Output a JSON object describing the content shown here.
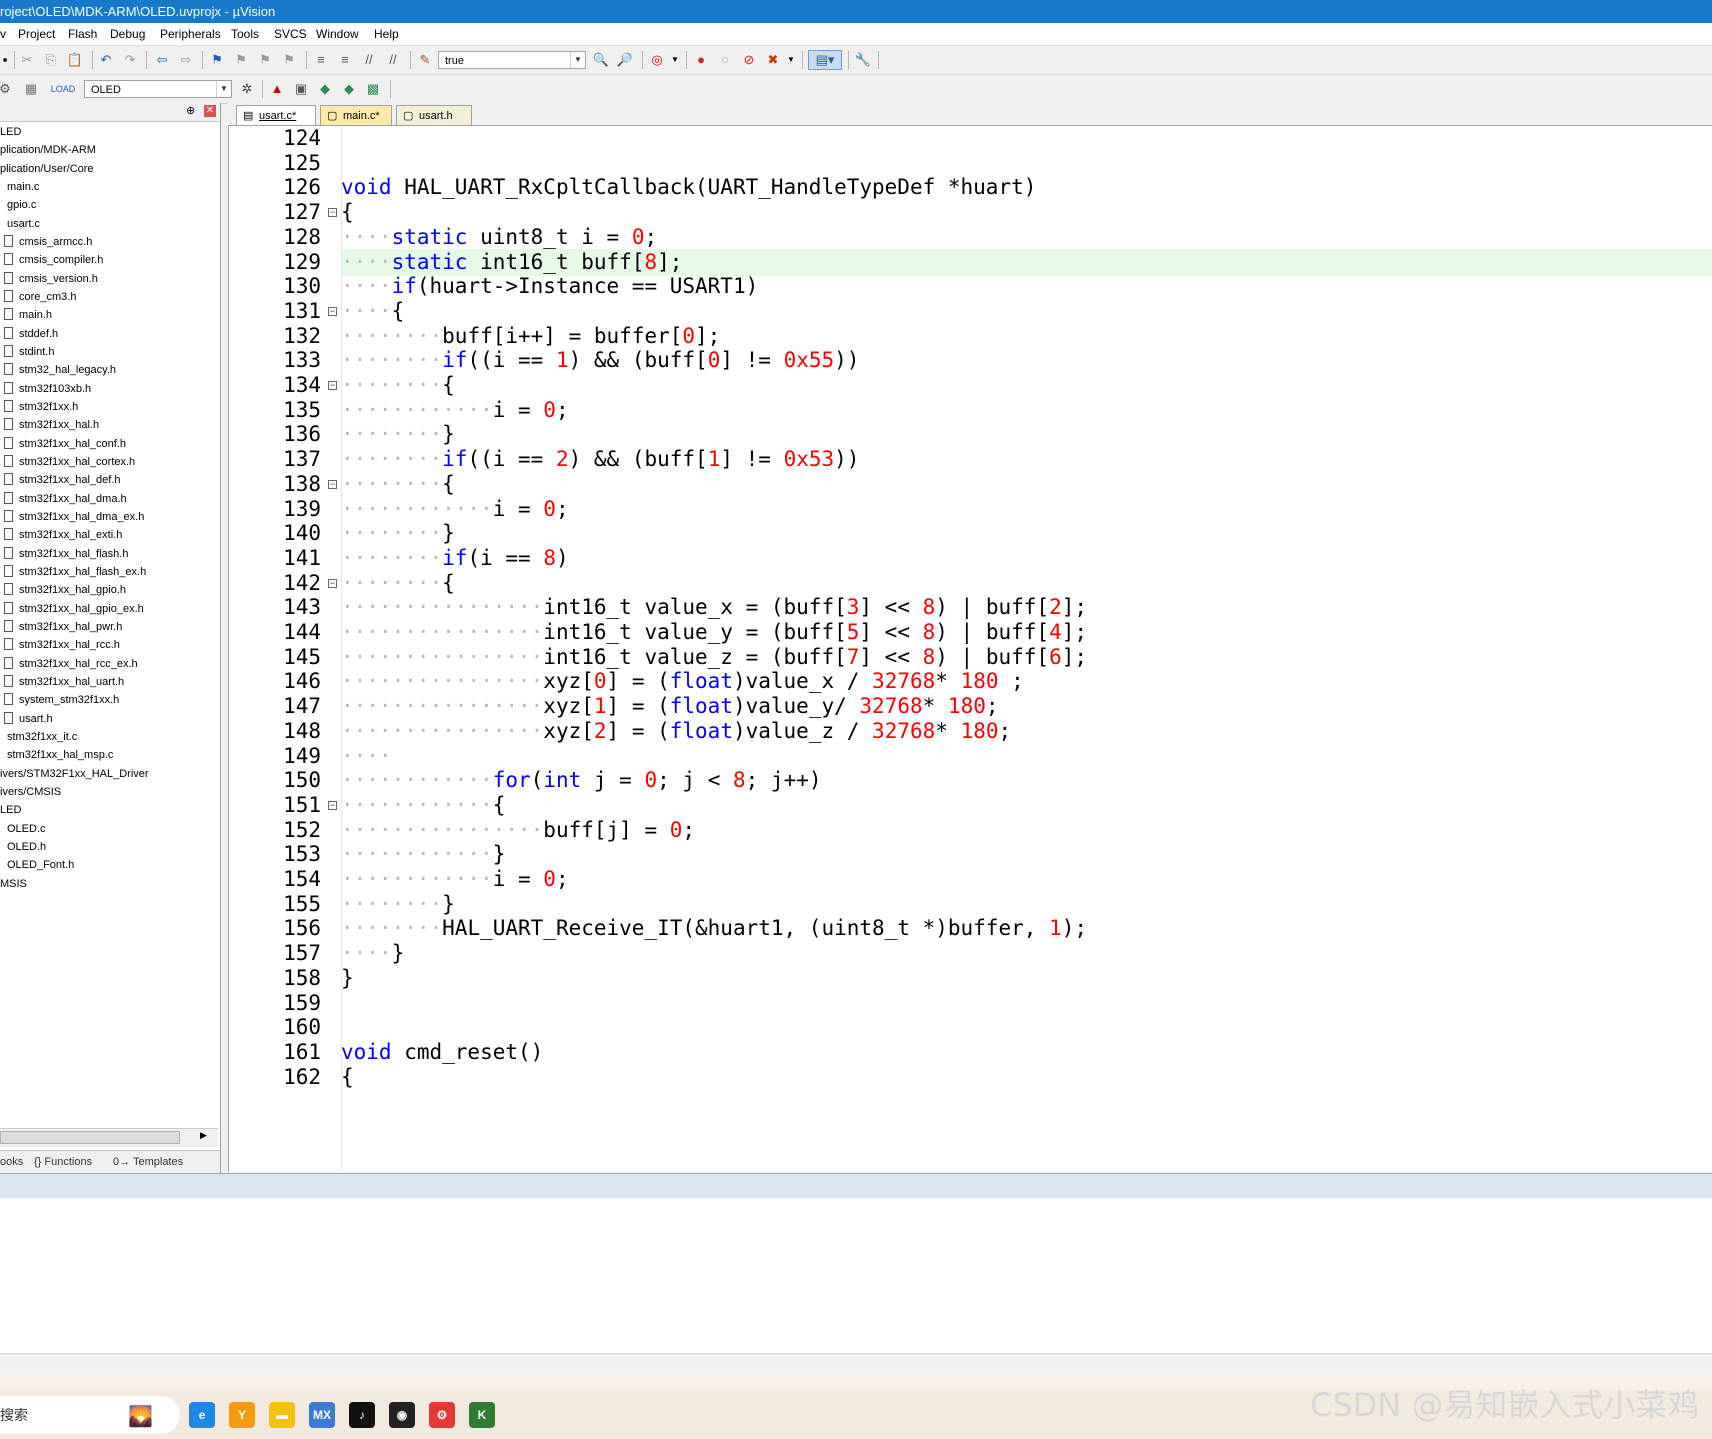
{
  "window": {
    "title": "roject\\OLED\\MDK-ARM\\OLED.uvprojx - µVision"
  },
  "menu": {
    "items": [
      "v",
      "Project",
      "Flash",
      "Debug",
      "Peripherals",
      "Tools",
      "SVCS",
      "Window",
      "Help"
    ]
  },
  "toolbar": {
    "find_combo_value": "true",
    "target_combo_value": "OLED"
  },
  "project": {
    "items": [
      {
        "label": "LED",
        "indent": 0,
        "file": false
      },
      {
        "label": "plication/MDK-ARM",
        "indent": 0,
        "file": false
      },
      {
        "label": "plication/User/Core",
        "indent": 0,
        "file": false
      },
      {
        "label": "main.c",
        "indent": 1,
        "file": false
      },
      {
        "label": "gpio.c",
        "indent": 1,
        "file": false
      },
      {
        "label": "usart.c",
        "indent": 1,
        "file": false
      },
      {
        "label": "cmsis_armcc.h",
        "indent": 2,
        "file": true
      },
      {
        "label": "cmsis_compiler.h",
        "indent": 2,
        "file": true
      },
      {
        "label": "cmsis_version.h",
        "indent": 2,
        "file": true
      },
      {
        "label": "core_cm3.h",
        "indent": 2,
        "file": true
      },
      {
        "label": "main.h",
        "indent": 2,
        "file": true
      },
      {
        "label": "stddef.h",
        "indent": 2,
        "file": true
      },
      {
        "label": "stdint.h",
        "indent": 2,
        "file": true
      },
      {
        "label": "stm32_hal_legacy.h",
        "indent": 2,
        "file": true
      },
      {
        "label": "stm32f103xb.h",
        "indent": 2,
        "file": true
      },
      {
        "label": "stm32f1xx.h",
        "indent": 2,
        "file": true
      },
      {
        "label": "stm32f1xx_hal.h",
        "indent": 2,
        "file": true
      },
      {
        "label": "stm32f1xx_hal_conf.h",
        "indent": 2,
        "file": true
      },
      {
        "label": "stm32f1xx_hal_cortex.h",
        "indent": 2,
        "file": true
      },
      {
        "label": "stm32f1xx_hal_def.h",
        "indent": 2,
        "file": true
      },
      {
        "label": "stm32f1xx_hal_dma.h",
        "indent": 2,
        "file": true
      },
      {
        "label": "stm32f1xx_hal_dma_ex.h",
        "indent": 2,
        "file": true
      },
      {
        "label": "stm32f1xx_hal_exti.h",
        "indent": 2,
        "file": true
      },
      {
        "label": "stm32f1xx_hal_flash.h",
        "indent": 2,
        "file": true
      },
      {
        "label": "stm32f1xx_hal_flash_ex.h",
        "indent": 2,
        "file": true
      },
      {
        "label": "stm32f1xx_hal_gpio.h",
        "indent": 2,
        "file": true
      },
      {
        "label": "stm32f1xx_hal_gpio_ex.h",
        "indent": 2,
        "file": true
      },
      {
        "label": "stm32f1xx_hal_pwr.h",
        "indent": 2,
        "file": true
      },
      {
        "label": "stm32f1xx_hal_rcc.h",
        "indent": 2,
        "file": true
      },
      {
        "label": "stm32f1xx_hal_rcc_ex.h",
        "indent": 2,
        "file": true
      },
      {
        "label": "stm32f1xx_hal_uart.h",
        "indent": 2,
        "file": true
      },
      {
        "label": "system_stm32f1xx.h",
        "indent": 2,
        "file": true
      },
      {
        "label": "usart.h",
        "indent": 2,
        "file": true
      },
      {
        "label": "stm32f1xx_it.c",
        "indent": 1,
        "file": false
      },
      {
        "label": "stm32f1xx_hal_msp.c",
        "indent": 1,
        "file": false
      },
      {
        "label": "ivers/STM32F1xx_HAL_Driver",
        "indent": 0,
        "file": false
      },
      {
        "label": "ivers/CMSIS",
        "indent": 0,
        "file": false
      },
      {
        "label": "LED",
        "indent": 0,
        "file": false
      },
      {
        "label": "OLED.c",
        "indent": 1,
        "file": false
      },
      {
        "label": "OLED.h",
        "indent": 1,
        "file": false
      },
      {
        "label": "OLED_Font.h",
        "indent": 1,
        "file": false
      },
      {
        "label": "MSIS",
        "indent": 0,
        "file": false
      }
    ],
    "bottom_tabs": {
      "books": "ooks",
      "functions": "{} Functions",
      "templates": "0→ Templates"
    }
  },
  "editor": {
    "tabs": [
      {
        "label": "usart.c*",
        "active": true
      },
      {
        "label": "main.c*",
        "active": false
      },
      {
        "label": "usart.h",
        "active": false
      }
    ],
    "highlight_line": 129,
    "lines": [
      {
        "n": "124",
        "dots": "",
        "segs": []
      },
      {
        "n": "125",
        "dots": "",
        "segs": []
      },
      {
        "n": "126",
        "dots": "",
        "segs": [
          [
            "k",
            "void"
          ],
          [
            "p",
            " HAL_UART_RxCpltCallback(UART_HandleTypeDef *huart)"
          ]
        ]
      },
      {
        "n": "127",
        "fold": true,
        "dots": "",
        "segs": [
          [
            "p",
            "{"
          ]
        ]
      },
      {
        "n": "128",
        "dots": "····",
        "segs": [
          [
            "k",
            "static"
          ],
          [
            "p",
            " uint8_t i = "
          ],
          [
            "n",
            "0"
          ],
          [
            "p",
            ";"
          ]
        ]
      },
      {
        "n": "129",
        "dots": "····",
        "segs": [
          [
            "k",
            "static"
          ],
          [
            "p",
            " int16_t buff["
          ],
          [
            "n",
            "8"
          ],
          [
            "p",
            "];"
          ]
        ]
      },
      {
        "n": "130",
        "dots": "····",
        "segs": [
          [
            "k",
            "if"
          ],
          [
            "p",
            "(huart->Instance == USART1)"
          ]
        ]
      },
      {
        "n": "131",
        "fold": true,
        "dots": "····",
        "segs": [
          [
            "p",
            "{"
          ]
        ]
      },
      {
        "n": "132",
        "dots": "········",
        "segs": [
          [
            "p",
            "buff[i++] = buffer["
          ],
          [
            "n",
            "0"
          ],
          [
            "p",
            "];"
          ]
        ]
      },
      {
        "n": "133",
        "dots": "········",
        "segs": [
          [
            "k",
            "if"
          ],
          [
            "p",
            "((i == "
          ],
          [
            "n",
            "1"
          ],
          [
            "p",
            ") && (buff["
          ],
          [
            "n",
            "0"
          ],
          [
            "p",
            "] != "
          ],
          [
            "n",
            "0x55"
          ],
          [
            "p",
            "))"
          ]
        ]
      },
      {
        "n": "134",
        "fold": true,
        "dots": "········",
        "segs": [
          [
            "p",
            "{"
          ]
        ]
      },
      {
        "n": "135",
        "dots": "············",
        "segs": [
          [
            "p",
            "i = "
          ],
          [
            "n",
            "0"
          ],
          [
            "p",
            ";"
          ]
        ]
      },
      {
        "n": "136",
        "dots": "········",
        "segs": [
          [
            "p",
            "}"
          ]
        ]
      },
      {
        "n": "137",
        "dots": "········",
        "segs": [
          [
            "k",
            "if"
          ],
          [
            "p",
            "((i == "
          ],
          [
            "n",
            "2"
          ],
          [
            "p",
            ") && (buff["
          ],
          [
            "n",
            "1"
          ],
          [
            "p",
            "] != "
          ],
          [
            "n",
            "0x53"
          ],
          [
            "p",
            "))"
          ]
        ]
      },
      {
        "n": "138",
        "fold": true,
        "dots": "········",
        "segs": [
          [
            "p",
            "{"
          ]
        ]
      },
      {
        "n": "139",
        "dots": "············",
        "segs": [
          [
            "p",
            "i = "
          ],
          [
            "n",
            "0"
          ],
          [
            "p",
            ";"
          ]
        ]
      },
      {
        "n": "140",
        "dots": "········",
        "segs": [
          [
            "p",
            "}"
          ]
        ]
      },
      {
        "n": "141",
        "dots": "········",
        "segs": [
          [
            "k",
            "if"
          ],
          [
            "p",
            "(i == "
          ],
          [
            "n",
            "8"
          ],
          [
            "p",
            ")"
          ]
        ]
      },
      {
        "n": "142",
        "fold": true,
        "dots": "········",
        "segs": [
          [
            "p",
            "{"
          ]
        ]
      },
      {
        "n": "143",
        "dots": "················",
        "segs": [
          [
            "p",
            "int16_t value_x = (buff["
          ],
          [
            "n",
            "3"
          ],
          [
            "p",
            "] << "
          ],
          [
            "n",
            "8"
          ],
          [
            "p",
            ") | buff["
          ],
          [
            "n",
            "2"
          ],
          [
            "p",
            "];"
          ]
        ]
      },
      {
        "n": "144",
        "dots": "················",
        "segs": [
          [
            "p",
            "int16_t value_y = (buff["
          ],
          [
            "n",
            "5"
          ],
          [
            "p",
            "] << "
          ],
          [
            "n",
            "8"
          ],
          [
            "p",
            ") | buff["
          ],
          [
            "n",
            "4"
          ],
          [
            "p",
            "];"
          ]
        ]
      },
      {
        "n": "145",
        "dots": "················",
        "segs": [
          [
            "p",
            "int16_t value_z = (buff["
          ],
          [
            "n",
            "7"
          ],
          [
            "p",
            "] << "
          ],
          [
            "n",
            "8"
          ],
          [
            "p",
            ") | buff["
          ],
          [
            "n",
            "6"
          ],
          [
            "p",
            "];"
          ]
        ]
      },
      {
        "n": "146",
        "dots": "················",
        "segs": [
          [
            "p",
            "xyz["
          ],
          [
            "n",
            "0"
          ],
          [
            "p",
            "] = ("
          ],
          [
            "k",
            "float"
          ],
          [
            "p",
            ")value_x / "
          ],
          [
            "n",
            "32768"
          ],
          [
            "p",
            "* "
          ],
          [
            "n",
            "180"
          ],
          [
            "p",
            " ;"
          ]
        ]
      },
      {
        "n": "147",
        "dots": "················",
        "segs": [
          [
            "p",
            "xyz["
          ],
          [
            "n",
            "1"
          ],
          [
            "p",
            "] = ("
          ],
          [
            "k",
            "float"
          ],
          [
            "p",
            ")value_y/ "
          ],
          [
            "n",
            "32768"
          ],
          [
            "p",
            "* "
          ],
          [
            "n",
            "180"
          ],
          [
            "p",
            ";"
          ]
        ]
      },
      {
        "n": "148",
        "dots": "················",
        "segs": [
          [
            "p",
            "xyz["
          ],
          [
            "n",
            "2"
          ],
          [
            "p",
            "] = ("
          ],
          [
            "k",
            "float"
          ],
          [
            "p",
            ")value_z / "
          ],
          [
            "n",
            "32768"
          ],
          [
            "p",
            "* "
          ],
          [
            "n",
            "180"
          ],
          [
            "p",
            ";"
          ]
        ]
      },
      {
        "n": "149",
        "dots": "····",
        "segs": []
      },
      {
        "n": "150",
        "dots": "············",
        "segs": [
          [
            "k",
            "for"
          ],
          [
            "p",
            "("
          ],
          [
            "k",
            "int"
          ],
          [
            "p",
            " j = "
          ],
          [
            "n",
            "0"
          ],
          [
            "p",
            "; j < "
          ],
          [
            "n",
            "8"
          ],
          [
            "p",
            "; j++)"
          ]
        ]
      },
      {
        "n": "151",
        "fold": true,
        "dots": "············",
        "segs": [
          [
            "p",
            "{"
          ]
        ]
      },
      {
        "n": "152",
        "dots": "················",
        "segs": [
          [
            "p",
            "buff[j] = "
          ],
          [
            "n",
            "0"
          ],
          [
            "p",
            ";"
          ]
        ]
      },
      {
        "n": "153",
        "dots": "············",
        "segs": [
          [
            "p",
            "}"
          ]
        ]
      },
      {
        "n": "154",
        "dots": "············",
        "segs": [
          [
            "p",
            "i = "
          ],
          [
            "n",
            "0"
          ],
          [
            "p",
            ";"
          ]
        ]
      },
      {
        "n": "155",
        "dots": "········",
        "segs": [
          [
            "p",
            "}"
          ]
        ]
      },
      {
        "n": "156",
        "dots": "········",
        "segs": [
          [
            "p",
            "HAL_UART_Receive_IT(&huart1, (uint8_t *)buffer, "
          ],
          [
            "n",
            "1"
          ],
          [
            "p",
            ");"
          ]
        ]
      },
      {
        "n": "157",
        "dots": "····",
        "segs": [
          [
            "p",
            "}"
          ]
        ]
      },
      {
        "n": "158",
        "dots": "",
        "segs": [
          [
            "p",
            "}"
          ]
        ]
      },
      {
        "n": "159",
        "dots": "",
        "segs": []
      },
      {
        "n": "160",
        "dots": "",
        "segs": []
      },
      {
        "n": "161",
        "dots": "",
        "segs": [
          [
            "k",
            "void"
          ],
          [
            "p",
            " cmd_reset()"
          ]
        ]
      },
      {
        "n": "162",
        "dots": "",
        "segs": [
          [
            "p",
            "{"
          ]
        ]
      }
    ]
  },
  "taskbar": {
    "search_text": "搜索",
    "apps": [
      {
        "name": "edge",
        "glyph": "e",
        "color": "#1e88e5"
      },
      {
        "name": "app-orange",
        "glyph": "Y",
        "color": "#f39c12"
      },
      {
        "name": "explorer",
        "glyph": "▬",
        "color": "#f4c20d"
      },
      {
        "name": "stm32cubemx",
        "glyph": "MX",
        "color": "#3a7bd5"
      },
      {
        "name": "tiktok",
        "glyph": "♪",
        "color": "#111111"
      },
      {
        "name": "qq",
        "glyph": "◉",
        "color": "#222222"
      },
      {
        "name": "tool-red",
        "glyph": "⚙",
        "color": "#e53935"
      },
      {
        "name": "keil",
        "glyph": "K",
        "color": "#2e7d32"
      }
    ]
  },
  "watermark": "CSDN @易知嵌入式小菜鸡"
}
